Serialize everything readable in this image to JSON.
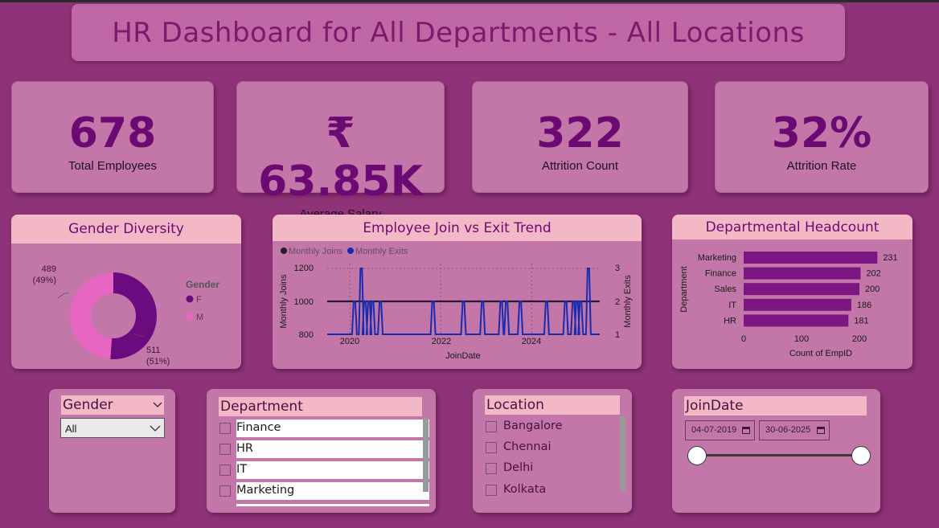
{
  "header": {
    "title": "HR Dashboard for All Departments - All Locations"
  },
  "kpis": {
    "total_employees": {
      "value": "678",
      "label": "Total Employees"
    },
    "average_salary": {
      "value": "₹ 63.85K",
      "label": "Average Salary"
    },
    "attrition_count": {
      "value": "322",
      "label": "Attrition Count"
    },
    "attrition_rate": {
      "value": "32%",
      "label": "Attrition Rate"
    }
  },
  "colors": {
    "female": "#6c0a80",
    "male": "#e766c2",
    "bar": "#7c1682",
    "joins_line": "#2b1a2c",
    "exits_line": "#1a2bb0"
  },
  "chart_data": [
    {
      "type": "pie",
      "title": "Gender Diversity",
      "legend_title": "Gender",
      "legend_position": "right",
      "slices": [
        {
          "name": "F",
          "value": 511,
          "label_value": "511",
          "label_pct": "(51%)"
        },
        {
          "name": "M",
          "value": 489,
          "label_value": "489",
          "label_pct": "(49%)"
        }
      ]
    },
    {
      "type": "line",
      "title": "Employee Join vs Exit Trend",
      "xlabel": "JoinDate",
      "ylabel_left": "Monthly Joins",
      "ylabel_right": "Monthly Exits",
      "legend_position": "top-left",
      "x_ticks": [
        "2020",
        "2022",
        "2024"
      ],
      "x_range": [
        2019.5,
        2025.5
      ],
      "y_left_ticks": [
        "1200",
        "1000",
        "800"
      ],
      "y_left_range": [
        800,
        1200
      ],
      "y_right_ticks": [
        "3",
        "2",
        "1"
      ],
      "y_right_range": [
        1,
        3
      ],
      "series": [
        {
          "name": "Monthly Joins",
          "axis": "left",
          "points": [
            [
              2019.5,
              1000
            ],
            [
              2025.5,
              1000
            ]
          ]
        },
        {
          "name": "Monthly Exits",
          "axis": "right",
          "spikes": [
            {
              "x": 2020.1,
              "y": 2
            },
            {
              "x": 2020.25,
              "y": 3
            },
            {
              "x": 2020.33,
              "y": 2
            },
            {
              "x": 2020.42,
              "y": 2
            },
            {
              "x": 2020.5,
              "y": 2
            },
            {
              "x": 2020.67,
              "y": 2
            },
            {
              "x": 2021.83,
              "y": 2
            },
            {
              "x": 2022.5,
              "y": 2
            },
            {
              "x": 2022.92,
              "y": 2
            },
            {
              "x": 2023.33,
              "y": 2
            },
            {
              "x": 2023.45,
              "y": 2
            },
            {
              "x": 2023.75,
              "y": 2
            },
            {
              "x": 2024.33,
              "y": 2
            },
            {
              "x": 2024.75,
              "y": 2
            },
            {
              "x": 2024.92,
              "y": 2
            },
            {
              "x": 2025.0,
              "y": 2
            },
            {
              "x": 2025.08,
              "y": 2
            },
            {
              "x": 2025.25,
              "y": 3
            }
          ]
        }
      ]
    },
    {
      "type": "bar",
      "orientation": "horizontal",
      "title": "Departmental Headcount",
      "categories": [
        "Marketing",
        "Finance",
        "Sales",
        "IT",
        "HR"
      ],
      "values": [
        231,
        202,
        200,
        186,
        181
      ],
      "xlabel": "Count of EmpID",
      "ylabel": "Department",
      "x_ticks": [
        "0",
        "100",
        "200"
      ],
      "xlim": [
        0,
        235
      ]
    }
  ],
  "slicers": {
    "gender": {
      "title": "Gender",
      "selected": "All"
    },
    "department": {
      "title": "Department",
      "items": [
        "Finance",
        "HR",
        "IT",
        "Marketing"
      ]
    },
    "location": {
      "title": "Location",
      "items": [
        "Bangalore",
        "Chennai",
        "Delhi",
        "Kolkata"
      ]
    },
    "joindate": {
      "title": "JoinDate",
      "start": "04-07-2019",
      "end": "30-06-2025"
    }
  }
}
